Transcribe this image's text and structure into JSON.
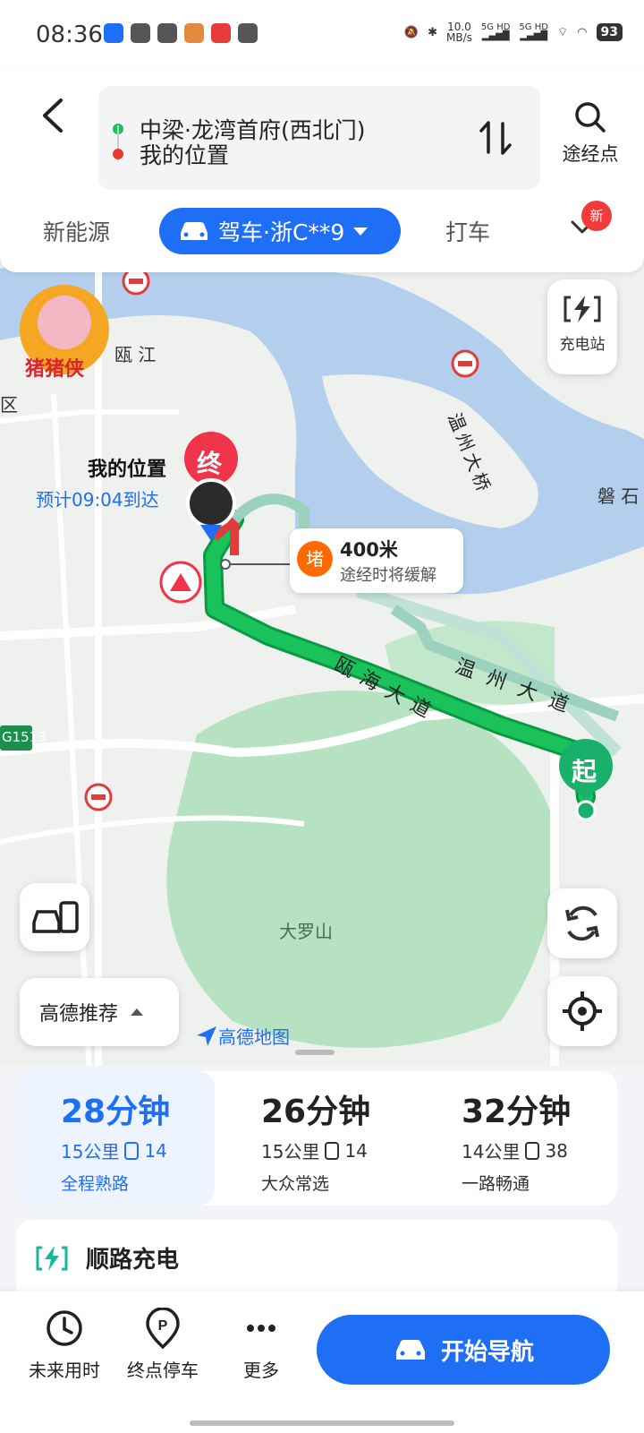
{
  "status_bar": {
    "time": "08:36",
    "net_speed": "10.0",
    "net_speed_unit": "MB/s",
    "net1": "5G HD",
    "net2": "5G HD",
    "battery": "93"
  },
  "header": {
    "origin": "中梁·龙湾首府(西北门)",
    "destination": "我的位置",
    "waypoint_label": "途经点",
    "tabs": {
      "new_energy": "新能源",
      "drive": "驾车·浙C**9",
      "taxi": "打车",
      "new_badge": "新"
    }
  },
  "map": {
    "labels": {
      "ou_jiang": "瓯 江",
      "qu": "区",
      "bridge": "温州大桥",
      "pan": "磐 石",
      "road_s": "G1513",
      "daluoshan": "大罗山",
      "wenzhou_road": "温 州 大 道",
      "ouhai_road": "瓯海大道"
    },
    "mascot_text": "猪猪侠",
    "end_marker": "终",
    "start_marker": "起",
    "my_location": "我的位置",
    "eta": "预计09:04到达",
    "jam": {
      "badge": "堵",
      "distance": "400米",
      "note": "途经时将缓解"
    },
    "charge_station": "充电站",
    "recommend": "高德推荐",
    "brand": "高德地图"
  },
  "routes": [
    {
      "time": "28分钟",
      "distance": "15公里",
      "lights": "14",
      "tag": "全程熟路",
      "selected": true
    },
    {
      "time": "26分钟",
      "distance": "15公里",
      "lights": "14",
      "tag": "大众常选",
      "selected": false
    },
    {
      "time": "32分钟",
      "distance": "14公里",
      "lights": "38",
      "tag": "一路畅通",
      "selected": false
    }
  ],
  "charge_card": {
    "label": "顺路充电"
  },
  "bottom_bar": {
    "future_time": "未来用时",
    "parking": "终点停车",
    "more": "更多",
    "start": "开始导航"
  },
  "colors": {
    "accent": "#1f6ef6",
    "route_green": "#19c25a",
    "jam_orange": "#ff6a00",
    "end_red": "#f0344a"
  }
}
